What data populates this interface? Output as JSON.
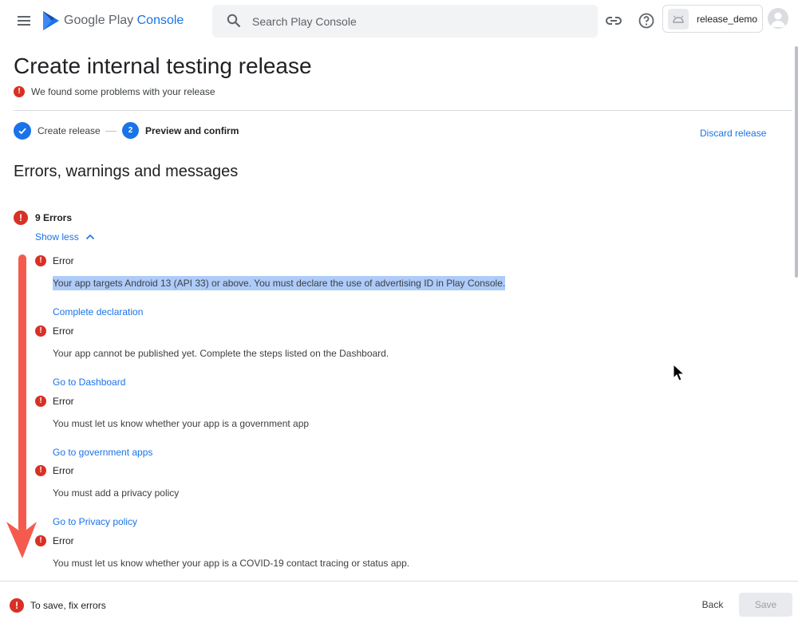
{
  "header": {
    "brand_google": "Google Play",
    "brand_console": "Console",
    "search_placeholder": "Search Play Console",
    "account_app_name": "release_demo"
  },
  "page": {
    "title": "Create internal testing release",
    "problem_notice": "We found some problems with your release"
  },
  "stepper": {
    "step1_label": "Create release",
    "step2_number": "2",
    "step2_label": "Preview and confirm",
    "discard_label": "Discard release"
  },
  "section": {
    "title": "Errors, warnings and messages",
    "error_count_label": "9 Errors",
    "show_less_label": "Show less"
  },
  "errors": [
    {
      "label": "Error",
      "message": "Your app targets Android 13 (API 33) or above. You must declare the use of advertising ID in Play Console.",
      "link": "Complete declaration",
      "highlighted": true
    },
    {
      "label": "Error",
      "message": "Your app cannot be published yet. Complete the steps listed on the Dashboard.",
      "link": "Go to Dashboard"
    },
    {
      "label": "Error",
      "message": "You must let us know whether your app is a government app",
      "link": "Go to government apps"
    },
    {
      "label": "Error",
      "message": "You must add a privacy policy",
      "link": "Go to Privacy policy"
    },
    {
      "label": "Error",
      "message": "You must let us know whether your app is a COVID-19 contact tracing or status app.",
      "link": ""
    }
  ],
  "footer": {
    "message": "To save, fix errors",
    "back_label": "Back",
    "save_label": "Save"
  },
  "colors": {
    "accent": "#1a73e8",
    "error": "#d93025",
    "highlight": "#aecbfa",
    "annotation_arrow": "#f45b4e"
  },
  "icons": [
    "menu-icon",
    "play-logo-icon",
    "search-icon",
    "link-icon",
    "help-icon",
    "app-icon",
    "avatar-icon",
    "check-icon",
    "error-icon",
    "chevron-up-icon",
    "cursor-icon"
  ]
}
